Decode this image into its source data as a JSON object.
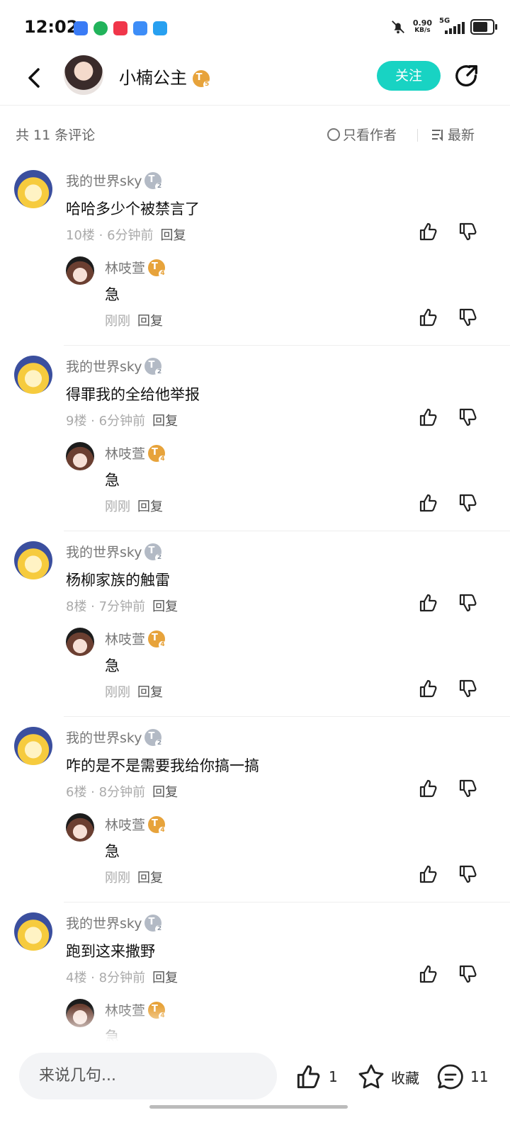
{
  "status_bar": {
    "time": "12:02",
    "net_speed_value": "0.90",
    "net_speed_unit": "KB/s",
    "network": "5G",
    "battery_level": 0.75
  },
  "header": {
    "title": "小楠公主",
    "level": "5",
    "follow_label": "关注"
  },
  "comments_header": {
    "count": "共 11 条评论",
    "only_author": "只看作者",
    "sort": "最新"
  },
  "comments": [
    {
      "name": "我的世界sky",
      "level": "2",
      "text": "哈哈多少个被禁言了",
      "floor": "10楼 · 6分钟前",
      "reply": "回复",
      "reply_item": {
        "name": "林吱萱",
        "level": "4",
        "text": "急",
        "time": "刚刚",
        "reply": "回复"
      }
    },
    {
      "name": "我的世界sky",
      "level": "2",
      "text": "得罪我的全给他举报",
      "floor": "9楼 · 6分钟前",
      "reply": "回复",
      "reply_item": {
        "name": "林吱萱",
        "level": "4",
        "text": "急",
        "time": "刚刚",
        "reply": "回复"
      }
    },
    {
      "name": "我的世界sky",
      "level": "2",
      "text": "杨柳家族的触雷",
      "floor": "8楼 · 7分钟前",
      "reply": "回复",
      "reply_item": {
        "name": "林吱萱",
        "level": "4",
        "text": "急",
        "time": "刚刚",
        "reply": "回复"
      }
    },
    {
      "name": "我的世界sky",
      "level": "2",
      "text": "咋的是不是需要我给你搞一搞",
      "floor": "6楼 · 8分钟前",
      "reply": "回复",
      "reply_item": {
        "name": "林吱萱",
        "level": "4",
        "text": "急",
        "time": "刚刚",
        "reply": "回复"
      }
    },
    {
      "name": "我的世界sky",
      "level": "2",
      "text": "跑到这来撒野",
      "floor": "4楼 · 8分钟前",
      "reply": "回复",
      "reply_item": {
        "name": "林吱萱",
        "level": "4",
        "text": "急",
        "time": "",
        "reply": ""
      }
    }
  ],
  "bottom_bar": {
    "input_placeholder": "来说几句...",
    "like_count": "1",
    "favorite_label": "收藏",
    "comment_count": "11"
  },
  "colors": {
    "accent": "#18d3c3",
    "badge_gold": "#e7a33b",
    "badge_gray": "#b3bac5"
  },
  "icons": [
    "back-icon",
    "share-icon",
    "radio-icon",
    "sort-icon",
    "thumbs-up-icon",
    "thumbs-down-icon",
    "star-icon",
    "comment-icon"
  ]
}
